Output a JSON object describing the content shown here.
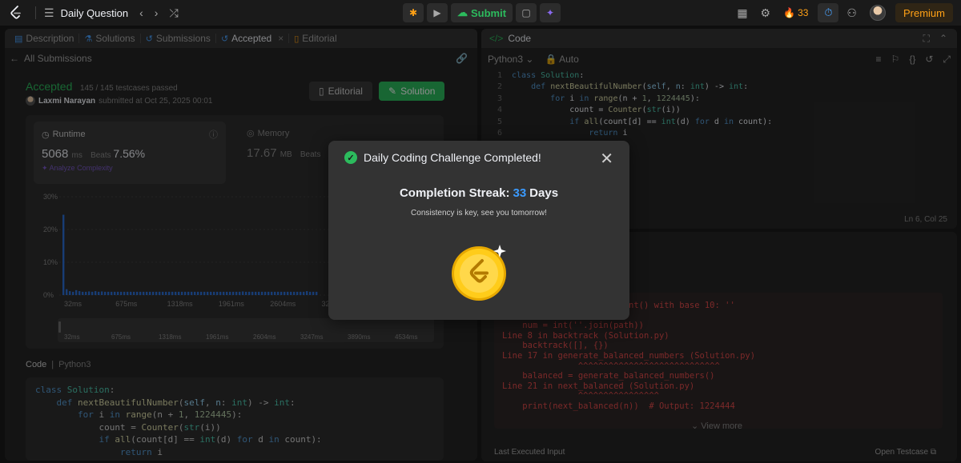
{
  "topbar": {
    "title": "Daily Question",
    "submit_label": "Submit",
    "streak_count": "33",
    "premium_label": "Premium"
  },
  "left_panel": {
    "tabs": [
      {
        "label": "Description",
        "icon": "document-icon"
      },
      {
        "label": "Solutions",
        "icon": "flask-icon"
      },
      {
        "label": "Submissions",
        "icon": "history-icon"
      },
      {
        "label": "Accepted",
        "icon": "history-icon"
      },
      {
        "label": "Editorial",
        "icon": "book-icon"
      }
    ],
    "back_label": "All Submissions",
    "result": {
      "status": "Accepted",
      "testcases": "145 / 145 testcases passed",
      "user": "Laxmi Narayan",
      "submitted_at": "submitted at Oct 25, 2025 00:01"
    },
    "editorial_button": "Editorial",
    "solution_button": "Solution",
    "runtime": {
      "label": "Runtime",
      "value": "5068",
      "unit": "ms",
      "beats_label": "Beats",
      "beats_value": "7.56%",
      "analyze_label": "Analyze Complexity"
    },
    "memory": {
      "label": "Memory",
      "value": "17.67",
      "unit": "MB",
      "beats_label": "Beats"
    },
    "code_header": {
      "label": "Code",
      "language": "Python3"
    },
    "code_lines": [
      "class Solution:",
      "    def nextBeautifulNumber(self, n: int) -> int:",
      "        for i in range(n + 1, 1224445):",
      "            count = Counter(str(i))",
      "            if all(count[d] == int(d) for d in count):",
      "                return i"
    ]
  },
  "chart_data": {
    "type": "bar",
    "y_ticks": [
      "30%",
      "20%",
      "10%",
      "0%"
    ],
    "ylim": [
      0,
      30
    ],
    "x_ticks": [
      "32ms",
      "675ms",
      "1318ms",
      "1961ms",
      "2604ms",
      "3247ms",
      "3890ms",
      "4534ms"
    ],
    "values": [
      24.5,
      1.8,
      1.2,
      1.0,
      1.5,
      1.2,
      1.0,
      1.0,
      1.1,
      1.0,
      1.2,
      1.0,
      1.1,
      1.0,
      1.0,
      1.0,
      1.0,
      1.0,
      1.0,
      1.0,
      1.0,
      1.0,
      1.0,
      1.0,
      1.0,
      1.0,
      1.0,
      1.0,
      1.0,
      1.0,
      1.0,
      1.0,
      1.0,
      1.0,
      1.0,
      1.0,
      1.0,
      1.0,
      1.0,
      1.0,
      1.0,
      1.0,
      1.0,
      1.0,
      1.0,
      1.0,
      1.0,
      1.0,
      1.0,
      1.0,
      1.0,
      1.0,
      1.0,
      1.0,
      1.0,
      1.0,
      1.1,
      1.0,
      1.0,
      1.0,
      1.0,
      1.0,
      1.0,
      1.0,
      1.0,
      1.0,
      1.0,
      1.0,
      1.0,
      1.0,
      1.0,
      1.0,
      1.0,
      1.0,
      1.0,
      1.0,
      1.2,
      1.0,
      1.0,
      1.0
    ]
  },
  "code_panel": {
    "title": "Code",
    "language": "Python3",
    "mode": "Auto",
    "lines": [
      "class Solution:",
      "    def nextBeautifulNumber(self, n: int) -> int:",
      "        for i in range(n + 1, 1224445):",
      "            count = Counter(str(i))",
      "            if all(count[d] == int(d) for d in count):",
      "                return i"
    ],
    "line_numbers": [
      "1",
      "2",
      "3",
      "4",
      "5",
      "6",
      "7"
    ],
    "cursor": "Ln 6, Col 25"
  },
  "console": {
    "error_lines": [
      "                    for int() with base 10: ''",
      "",
      "    num = int(''.join(path))",
      "Line 8 in backtrack (Solution.py)",
      "    backtrack([], {})",
      "Line 17 in generate_balanced_numbers (Solution.py)",
      "               ^^^^^^^^^^^^^^^^^^^^^^^^^^^^",
      "    balanced = generate_balanced_numbers()",
      "Line 21 in next_balanced (Solution.py)",
      "               ^^^^^^^^^^^^^^^^",
      "    print(next_balanced(n))  # Output: 1224444"
    ],
    "view_more": "View more",
    "last_input_label": "Last Executed Input",
    "open_testcase": "Open Testcase"
  },
  "modal": {
    "title": "Daily Coding Challenge Completed!",
    "streak_label": "Completion Streak:",
    "streak_count": "33",
    "streak_unit": "Days",
    "message": "Consistency is key, see you tomorrow!"
  },
  "colors": {
    "accent_green": "#2cbb5d",
    "streak_orange": "#ffa116",
    "streak_blue": "#3b9bff",
    "chart_bar": "#2d6fd6",
    "coin_gold": "#ffcc1a"
  }
}
